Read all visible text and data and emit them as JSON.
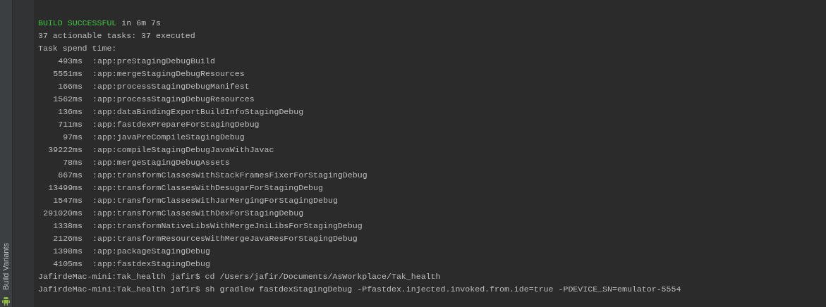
{
  "side_panel": {
    "tab_label": "Build Variants"
  },
  "console": {
    "build_result": {
      "status": "BUILD SUCCESSFUL",
      "duration": "in 6m 7s"
    },
    "summary_lines": [
      "37 actionable tasks: 37 executed",
      "Task spend time:"
    ],
    "task_times": [
      {
        "time": "493ms",
        "task": ":app:preStagingDebugBuild"
      },
      {
        "time": "5551ms",
        "task": ":app:mergeStagingDebugResources"
      },
      {
        "time": "166ms",
        "task": ":app:processStagingDebugManifest"
      },
      {
        "time": "1562ms",
        "task": ":app:processStagingDebugResources"
      },
      {
        "time": "136ms",
        "task": ":app:dataBindingExportBuildInfoStagingDebug"
      },
      {
        "time": "711ms",
        "task": ":app:fastdexPrepareForStagingDebug"
      },
      {
        "time": "97ms",
        "task": ":app:javaPreCompileStagingDebug"
      },
      {
        "time": "39222ms",
        "task": ":app:compileStagingDebugJavaWithJavac"
      },
      {
        "time": "78ms",
        "task": ":app:mergeStagingDebugAssets"
      },
      {
        "time": "667ms",
        "task": ":app:transformClassesWithStackFramesFixerForStagingDebug"
      },
      {
        "time": "13499ms",
        "task": ":app:transformClassesWithDesugarForStagingDebug"
      },
      {
        "time": "1547ms",
        "task": ":app:transformClassesWithJarMergingForStagingDebug"
      },
      {
        "time": "291020ms",
        "task": ":app:transformClassesWithDexForStagingDebug"
      },
      {
        "time": "1338ms",
        "task": ":app:transformNativeLibsWithMergeJniLibsForStagingDebug"
      },
      {
        "time": "2126ms",
        "task": ":app:transformResourcesWithMergeJavaResForStagingDebug"
      },
      {
        "time": "1398ms",
        "task": ":app:packageStagingDebug"
      },
      {
        "time": "4105ms",
        "task": ":app:fastdexStagingDebug"
      }
    ],
    "commands": [
      "JafirdeMac-mini:Tak_health jafir$ cd /Users/jafir/Documents/AsWorkplace/Tak_health",
      "JafirdeMac-mini:Tak_health jafir$ sh gradlew fastdexStagingDebug -Pfastdex.injected.invoked.from.ide=true -PDEVICE_SN=emulator-5554"
    ]
  }
}
